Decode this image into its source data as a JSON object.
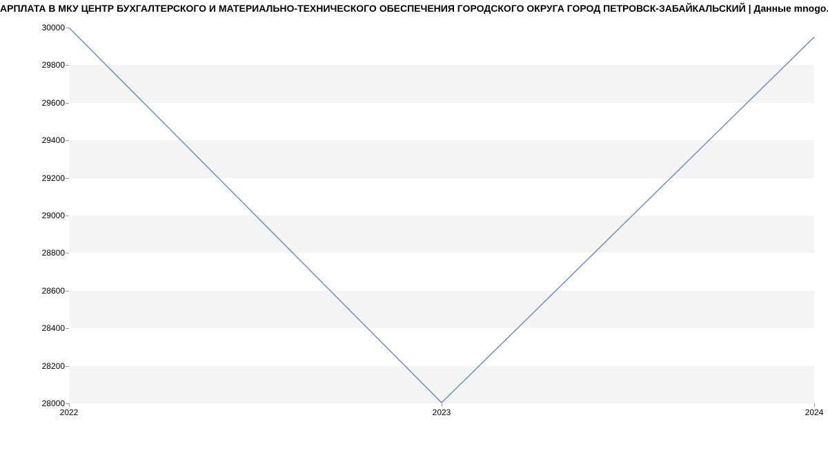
{
  "title": "АРПЛАТА В МКУ ЦЕНТР БУХГАЛТЕРСКОГО И МАТЕРИАЛЬНО-ТЕХНИЧЕСКОГО ОБЕСПЕЧЕНИЯ ГОРОДСКОГО ОКРУГА ГОРОД ПЕТРОВСК-ЗАБАЙКАЛЬСКИЙ | Данные mnogo.wor",
  "chart_data": {
    "type": "line",
    "x_labels": [
      "2022",
      "2023",
      "2024"
    ],
    "x": [
      2022,
      2023,
      2024
    ],
    "values": [
      30000,
      28000,
      29950
    ],
    "ylim": [
      28000,
      30000
    ],
    "xlim": [
      2022,
      2024
    ],
    "y_ticks": [
      28000,
      28200,
      28400,
      28600,
      28800,
      29000,
      29200,
      29400,
      29600,
      29800,
      30000
    ],
    "line_color": "#6b8ec7",
    "band_color": "#f4f4f4"
  }
}
